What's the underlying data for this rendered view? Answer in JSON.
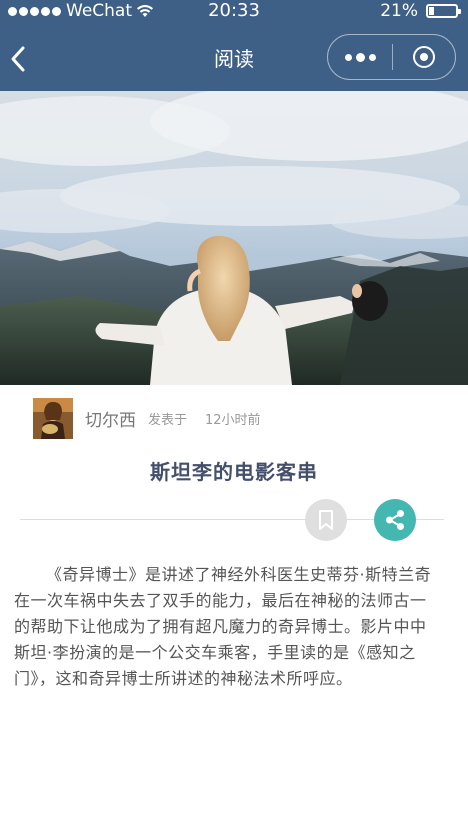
{
  "status_bar": {
    "carrier": "WeChat",
    "time": "20:33",
    "battery_text": "21%",
    "battery_level": 0.21
  },
  "nav": {
    "title": "阅读",
    "back_icon": "chevron-left-icon",
    "more_icon": "more-dots-icon",
    "close_icon": "target-close-icon"
  },
  "article": {
    "author": "切尔西",
    "posted_label": "发表于",
    "time_ago": "12小时前",
    "title": "斯坦李的电影客串",
    "body": "《奇异博士》是讲述了神经外科医生史蒂芬·斯特兰奇在一次车祸中失去了双手的能力，最后在神秘的法师古一的帮助下让他成为了拥有超凡魔力的奇异博士。影片中中斯坦·李扮演的是一个公交车乘客，手里读的是《感知之门》，这和奇异博士所讲述的神秘法术所呼应。"
  },
  "actions": {
    "bookmark_icon": "bookmark-icon",
    "share_icon": "share-icon"
  },
  "colors": {
    "nav_bg": "#3e5f86",
    "share_bg": "#44b7b1",
    "bookmark_bg": "#dfdfdf",
    "title_color": "#44506a"
  }
}
